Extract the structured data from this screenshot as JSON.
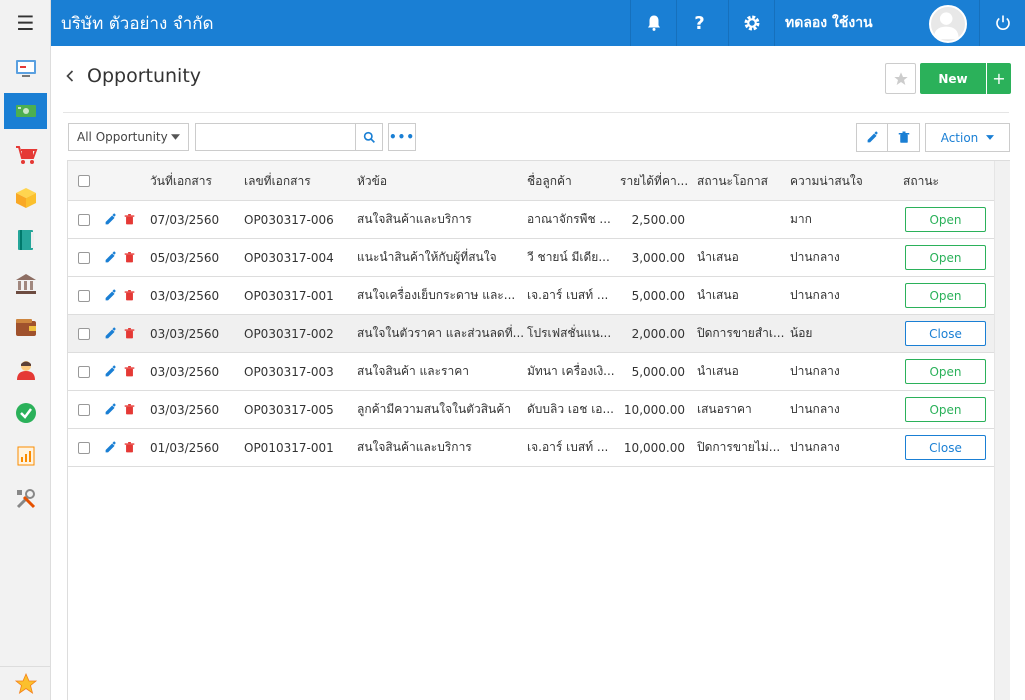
{
  "topbar": {
    "company": "บริษัท ตัวอย่าง จำกัด",
    "help_icon": "?",
    "user_name": "ทดลอง ใช้งาน"
  },
  "header": {
    "title": "Opportunity",
    "new_label": "New",
    "plus_label": "+"
  },
  "toolbar": {
    "filter_value": "All Opportunity",
    "search_value": "",
    "action_label": "Action"
  },
  "table": {
    "columns": [
      "วันที่เอกสาร",
      "เลขที่เอกสาร",
      "หัวข้อ",
      "ชื่อลูกค้า",
      "รายได้ที่คา...",
      "สถานะโอกาส",
      "ความน่าสนใจ",
      "สถานะ"
    ],
    "rows": [
      {
        "date": "07/03/2560",
        "doc_no": "OP030317-006",
        "subject": "สนใจสินค้าและบริการ",
        "customer": "อาณาจักรพืช ...",
        "revenue": "2,500.00",
        "opp_status": "",
        "interest": "มาก",
        "status": "Open"
      },
      {
        "date": "05/03/2560",
        "doc_no": "OP030317-004",
        "subject": "แนะนำสินค้าให้กับผู้ที่สนใจ",
        "customer": "วี ชายน์ มีเดีย...",
        "revenue": "3,000.00",
        "opp_status": "นำเสนอ",
        "interest": "ปานกลาง",
        "status": "Open"
      },
      {
        "date": "03/03/2560",
        "doc_no": "OP030317-001",
        "subject": "สนใจเครื่องเย็บกระดาษ และ...",
        "customer": "เจ.อาร์ เบสท์ ...",
        "revenue": "5,000.00",
        "opp_status": "นำเสนอ",
        "interest": "ปานกลาง",
        "status": "Open"
      },
      {
        "date": "03/03/2560",
        "doc_no": "OP030317-002",
        "subject": "สนใจในตัวราคา และส่วนลดที่...",
        "customer": "โปรเฟสชั่นแน...",
        "revenue": "2,000.00",
        "opp_status": "ปิดการขายสำเ...",
        "interest": "น้อย",
        "status": "Close"
      },
      {
        "date": "03/03/2560",
        "doc_no": "OP030317-003",
        "subject": "สนใจสินค้า และราคา",
        "customer": "มัทนา เครื่องเงิ...",
        "revenue": "5,000.00",
        "opp_status": "นำเสนอ",
        "interest": "ปานกลาง",
        "status": "Open"
      },
      {
        "date": "03/03/2560",
        "doc_no": "OP030317-005",
        "subject": "ลูกค้ามีความสนใจในตัวสินค้า",
        "customer": "ดับบลิว เอช เอ...",
        "revenue": "10,000.00",
        "opp_status": "เสนอราคา",
        "interest": "ปานกลาง",
        "status": "Open"
      },
      {
        "date": "01/03/2560",
        "doc_no": "OP010317-001",
        "subject": "สนใจสินค้าและบริการ",
        "customer": "เจ.อาร์ เบสท์ ...",
        "revenue": "10,000.00",
        "opp_status": "ปิดการขายไม่...",
        "interest": "ปานกลาง",
        "status": "Close"
      }
    ]
  },
  "sidebar": {
    "items": [
      {
        "icon": "dashboard-icon"
      },
      {
        "icon": "money-icon",
        "active": true
      },
      {
        "icon": "cart-icon"
      },
      {
        "icon": "box-icon"
      },
      {
        "icon": "book-icon"
      },
      {
        "icon": "bank-icon"
      },
      {
        "icon": "wallet-icon"
      },
      {
        "icon": "contacts-icon"
      },
      {
        "icon": "check-icon"
      },
      {
        "icon": "report-icon"
      },
      {
        "icon": "tools-icon"
      }
    ]
  },
  "colors": {
    "primary": "#1a7fd4",
    "success": "#2bb15a",
    "delete": "#e53935"
  }
}
